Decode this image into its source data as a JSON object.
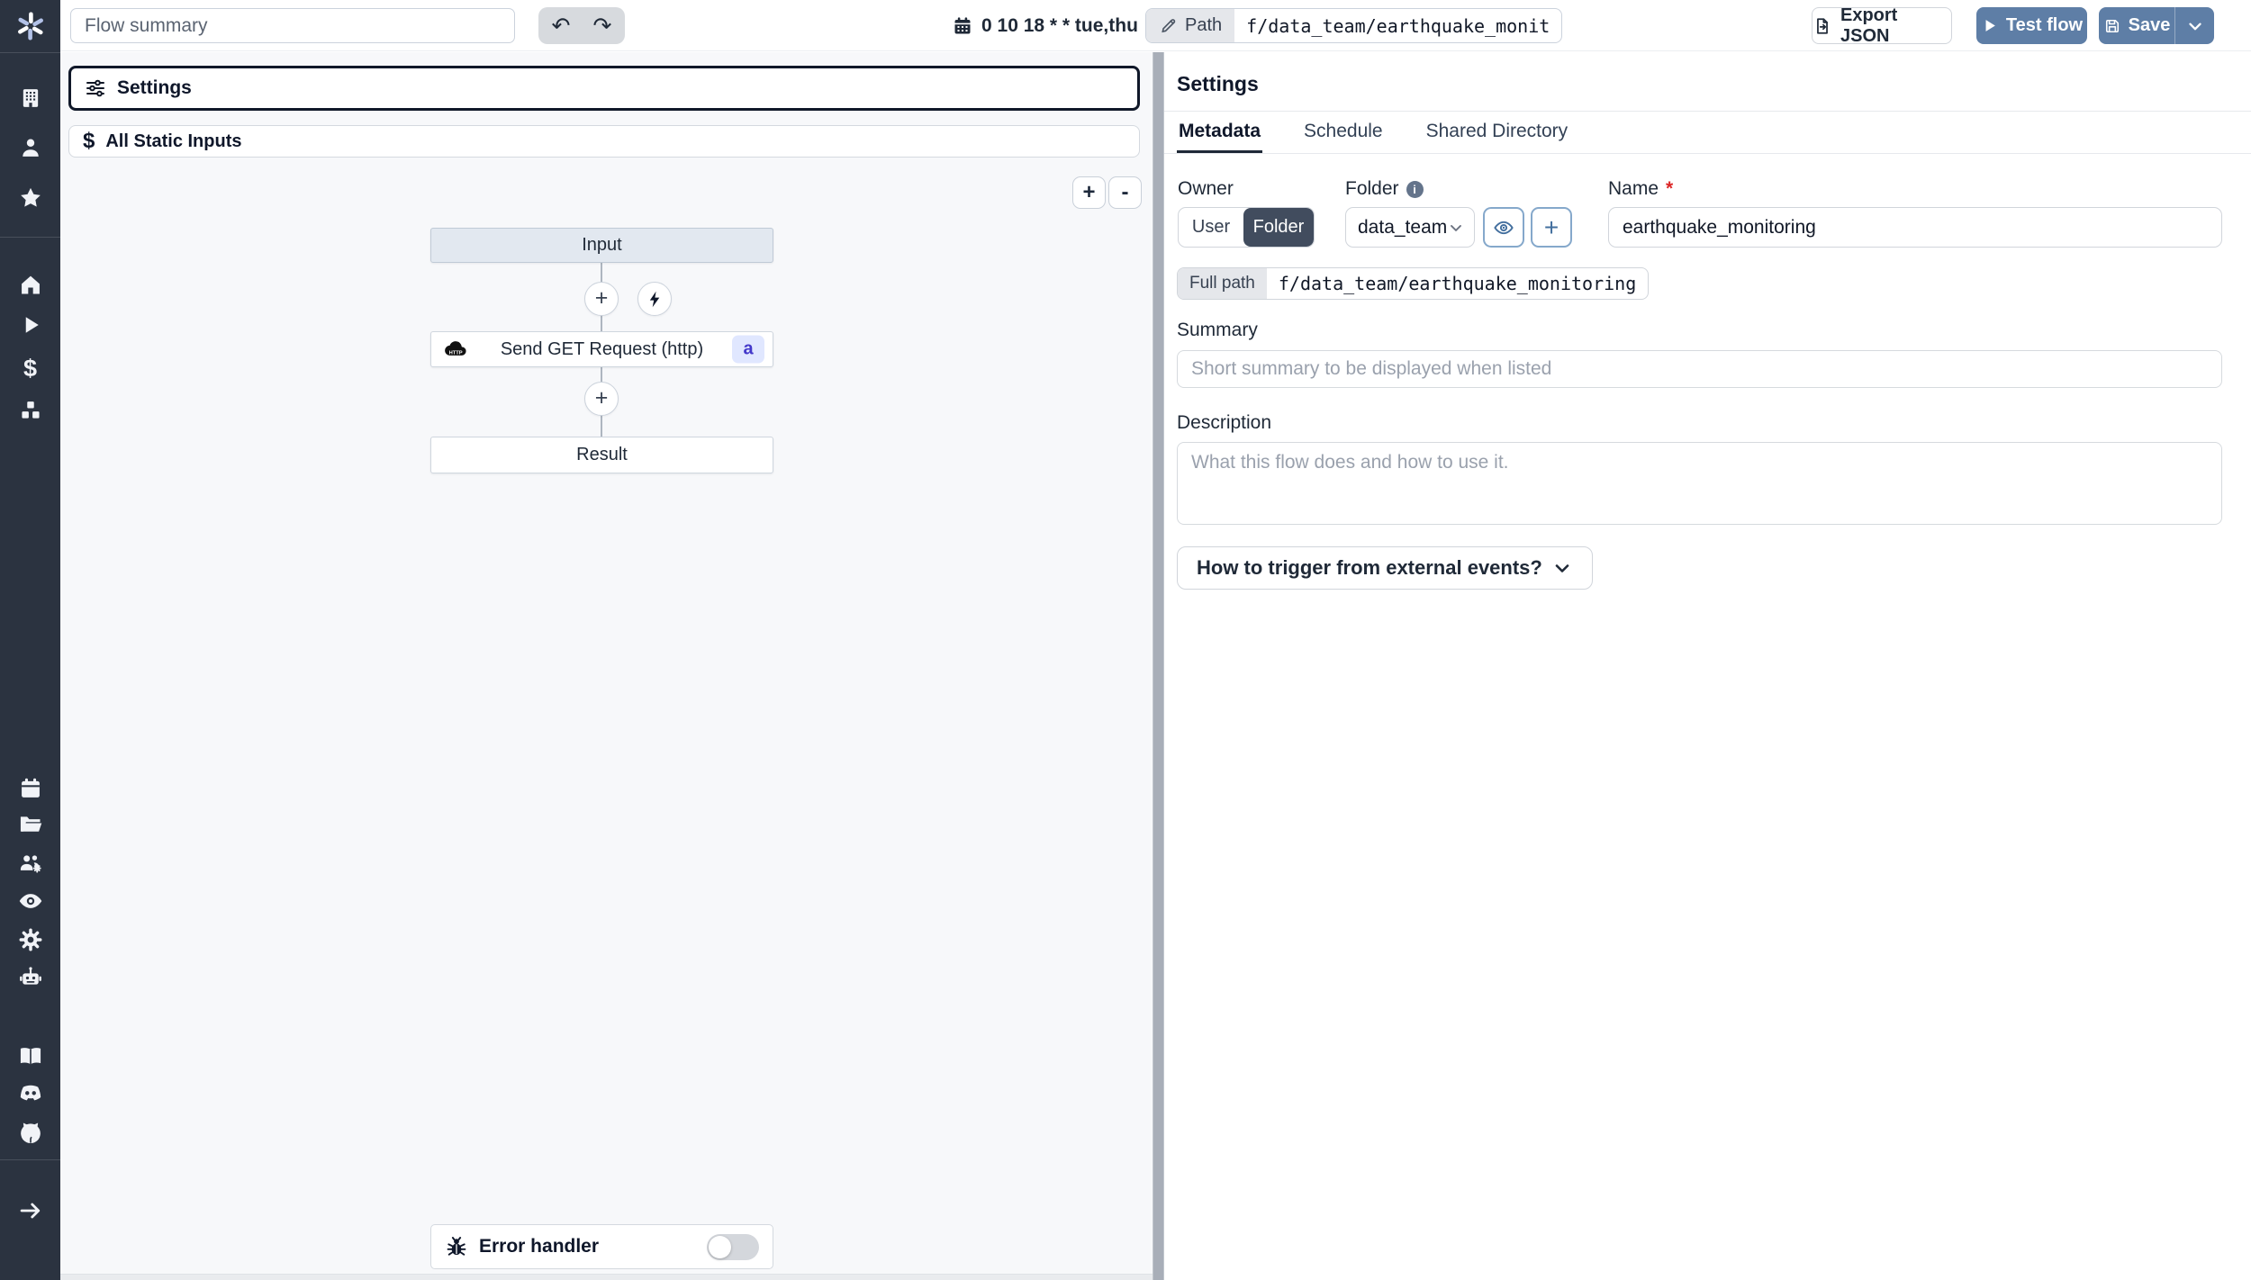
{
  "topbar": {
    "flow_summary_placeholder": "Flow summary",
    "undo_glyph": "↶",
    "redo_glyph": "↷",
    "schedule_cron": "0 10 18 * * tue,thu",
    "path_label": "Path",
    "path_value": "f/data_team/earthquake_monit",
    "export_json_label": "Export JSON",
    "test_flow_label": "Test flow",
    "save_label": "Save"
  },
  "sidebar": {
    "icons": [
      "windmill-logo",
      "building",
      "user",
      "star",
      "home",
      "play",
      "dollar",
      "cubes",
      "calendar",
      "folder-open",
      "users-gear",
      "eye",
      "gear",
      "robot",
      "book",
      "discord",
      "github",
      "arrow-right"
    ],
    "dollar_glyph": "$",
    "arrow_glyph": "→"
  },
  "flow_panel": {
    "settings_card_label": "Settings",
    "static_inputs_label": "All Static Inputs",
    "static_inputs_glyph": "$",
    "zoom_in_label": "+",
    "zoom_out_label": "-",
    "input_node_label": "Input",
    "step_node_label": "Send GET Request (http)",
    "step_node_badge": "a",
    "plus_glyph": "+",
    "result_node_label": "Result",
    "error_handler_label": "Error handler"
  },
  "settings_panel": {
    "title": "Settings",
    "tabs": [
      {
        "label": "Metadata",
        "active": true
      },
      {
        "label": "Schedule",
        "active": false
      },
      {
        "label": "Shared Directory",
        "active": false
      }
    ],
    "owner_label": "Owner",
    "owner_user": "User",
    "owner_folder": "Folder",
    "folder_label": "Folder",
    "folder_info_glyph": "i",
    "folder_value": "data_team",
    "name_label": "Name",
    "required_mark": "*",
    "name_value": "earthquake_monitoring",
    "full_path_label": "Full path",
    "full_path_value": "f/data_team/earthquake_monitoring",
    "summary_label": "Summary",
    "summary_placeholder": "Short summary to be displayed when listed",
    "description_label": "Description",
    "description_placeholder": "What this flow does and how to use it.",
    "trigger_question": "How to trigger from external events?"
  },
  "colors": {
    "accent_blue": "#5e7ea6",
    "sidebar_bg": "#2b3340",
    "badge_bg": "#e0e7ff",
    "badge_text": "#4338ca",
    "selected_outline": "#101829",
    "canvas_bg": "#f7f8fa"
  }
}
